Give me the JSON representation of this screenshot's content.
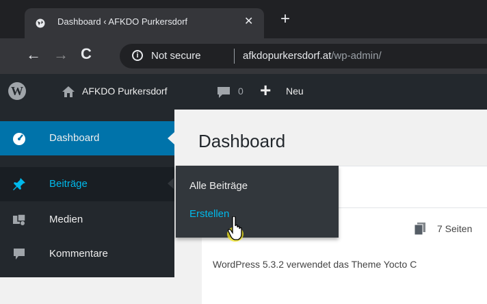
{
  "browser": {
    "tab_title": "Dashboard ‹ AFKDO Purkersdorf",
    "tab_close": "✕",
    "new_tab": "+",
    "security_label": "Not secure",
    "url_host": "afkdopurkersdorf.at",
    "url_path": "/wp-admin/"
  },
  "adminbar": {
    "site_name": "AFKDO Purkersdorf",
    "comment_count": "0",
    "new_label": "Neu"
  },
  "sidebar": {
    "items": [
      {
        "label": "Dashboard",
        "icon": "dashboard-icon"
      },
      {
        "label": "Beiträge",
        "icon": "pin-icon"
      },
      {
        "label": "Medien",
        "icon": "media-icon"
      },
      {
        "label": "Kommentare",
        "icon": "comment-icon"
      }
    ]
  },
  "submenu": {
    "items": [
      {
        "label": "Alle Beiträge"
      },
      {
        "label": "Erstellen"
      }
    ]
  },
  "main": {
    "title": "Dashboard",
    "pages_count": "7 Seiten",
    "wp_version_text": "WordPress 5.3.2 verwendet das Theme Yocto C"
  },
  "colors": {
    "admin_bar": "#23282d",
    "accent_blue": "#0073aa",
    "link_blue": "#00b9eb",
    "browser_dark": "#202124"
  }
}
